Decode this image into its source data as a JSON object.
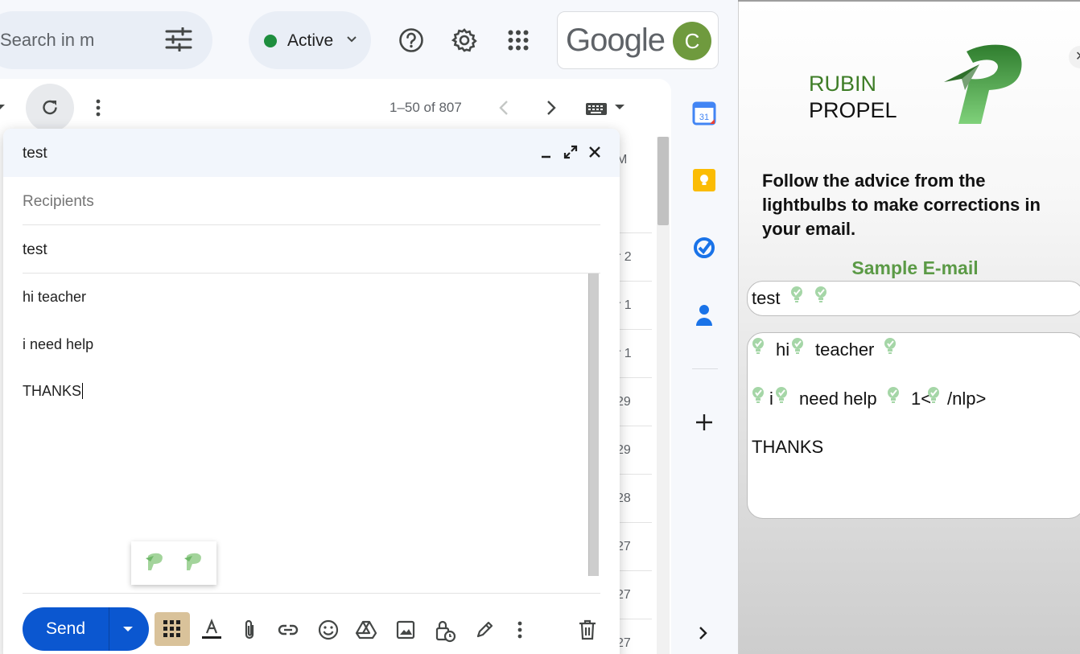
{
  "toolbar": {
    "search_placeholder": "Search in m",
    "status": "Active",
    "google_logo": "Google",
    "avatar_initial": "C"
  },
  "list": {
    "page_count": "1–50 of 807",
    "dates": [
      "M",
      "r 2",
      "r 1",
      "r 1",
      "29",
      "29",
      "28",
      "27",
      "27",
      "27"
    ]
  },
  "compose": {
    "title": "test",
    "recipients_placeholder": "Recipients",
    "subject": "test",
    "body_lines": [
      "hi teacher",
      "i need help",
      "THANKS"
    ],
    "send_label": "Send"
  },
  "panel": {
    "brand_line1": "RUBIN",
    "brand_line2": "PROPEL",
    "instructions": "Follow the advice from the lightbulbs to make corrections in your email.",
    "sample_title": "Sample E-mail",
    "sample_subject": "test",
    "sample_body": {
      "line1_a": "hi",
      "line1_b": "teacher",
      "line2_a": "i",
      "line2_b": "need help",
      "line2_c": "1<",
      "line2_d": "/nlp>",
      "line3": "THANKS"
    }
  },
  "colors": {
    "send_blue": "#0b57d0",
    "active_green": "#1e8e3e",
    "brand_green": "#3e7d27",
    "bulb_green": "#a5d6a7"
  },
  "icons": [
    "tune-icon",
    "help-icon",
    "settings-icon",
    "apps-icon",
    "refresh-icon",
    "more-icon",
    "keyboard-icon",
    "minimize-icon",
    "expand-icon",
    "close-icon",
    "format-text-icon",
    "attach-icon",
    "link-icon",
    "emoji-icon",
    "drive-icon",
    "photo-icon",
    "confidential-icon",
    "signature-icon",
    "trash-icon",
    "calendar-icon",
    "keep-icon",
    "tasks-icon",
    "contacts-icon",
    "plus-icon",
    "lightbulb-icon"
  ]
}
